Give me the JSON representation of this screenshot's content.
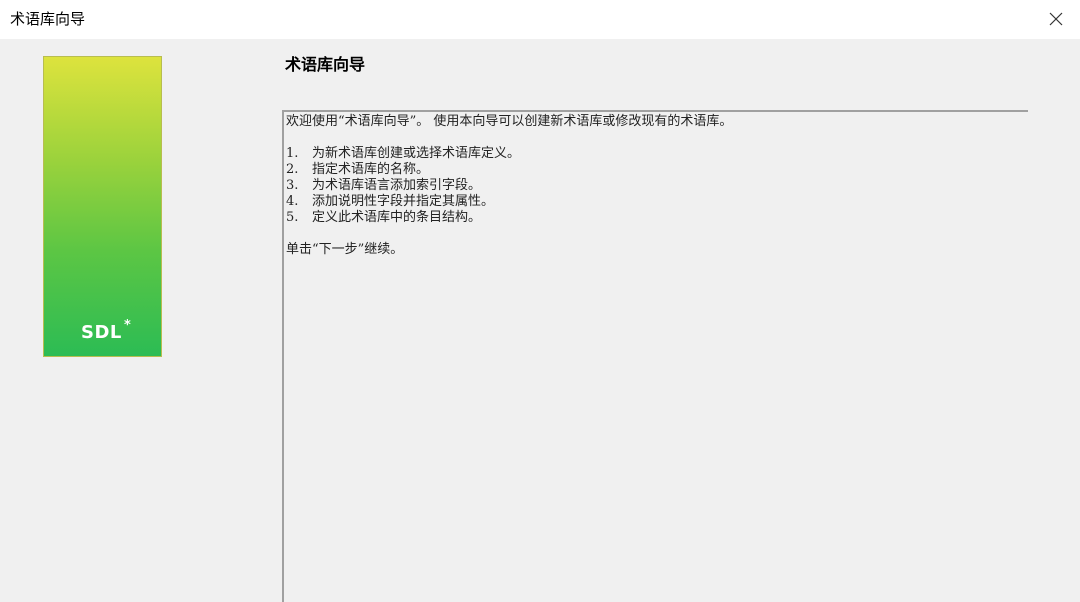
{
  "window": {
    "title": "术语库向导",
    "close_icon": "close-icon"
  },
  "sidebar": {
    "logo_text": "SDL",
    "logo_mark": "*",
    "gradient_colors": [
      "#dde33d",
      "#2cbc54"
    ]
  },
  "main": {
    "heading": "术语库向导",
    "intro": "欢迎使用“术语库向导”。 使用本向导可以创建新术语库或修改现有的术语库。",
    "steps": [
      {
        "num": "1.",
        "text": "为新术语库创建或选择术语库定义。"
      },
      {
        "num": "2.",
        "text": "指定术语库的名称。"
      },
      {
        "num": "3.",
        "text": "为术语库语言添加索引字段。"
      },
      {
        "num": "4.",
        "text": "添加说明性字段并指定其属性。"
      },
      {
        "num": "5.",
        "text": "定义此术语库中的条目结构。"
      }
    ],
    "continue_text": "单击“下一步”继续。"
  }
}
